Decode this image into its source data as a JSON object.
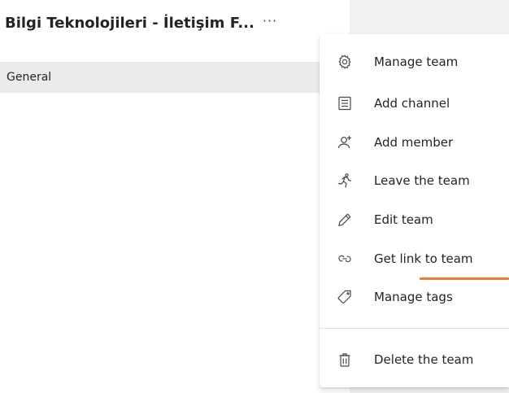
{
  "team": {
    "title": "Bilgi Teknolojileri - İletişim F...",
    "more_label": "···"
  },
  "channels": [
    {
      "label": "General"
    }
  ],
  "menu": {
    "items": [
      {
        "label": "Manage team",
        "icon": "gear-icon"
      },
      {
        "label": "Add channel",
        "icon": "channel-list-icon"
      },
      {
        "label": "Add member",
        "icon": "add-person-icon"
      },
      {
        "label": "Leave the team",
        "icon": "running-person-icon"
      },
      {
        "label": "Edit team",
        "icon": "pencil-icon"
      },
      {
        "label": "Get link to team",
        "icon": "link-icon"
      },
      {
        "label": "Manage tags",
        "icon": "tag-icon"
      },
      {
        "label": "Delete the team",
        "icon": "trash-icon"
      }
    ]
  },
  "colors": {
    "accent_underline": "#ed7d31",
    "selected_channel_bg": "#edebe9",
    "text": "#252423"
  }
}
